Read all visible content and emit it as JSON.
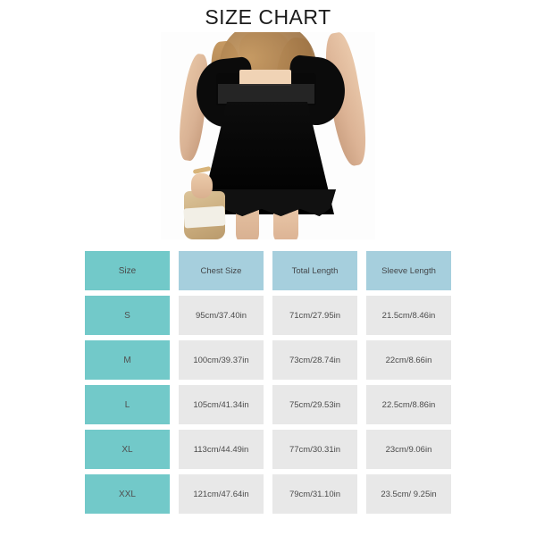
{
  "page": {
    "title": "SIZE CHART",
    "background_color": "#ffffff"
  },
  "colors": {
    "size_column": "#72c9c9",
    "header_measure_column": "#a6cfdd",
    "data_cell": "#e8e8e8",
    "title_text": "#1b1b1b",
    "cell_text": "#4a4a4a"
  },
  "photo": {
    "alt": "Model wearing black lace-trim flutter-sleeve babydoll top with straw bag",
    "garment_color": "#000000"
  },
  "table": {
    "headers": [
      "Size",
      "Chest Size",
      "Total Length",
      "Sleeve Length"
    ],
    "rows": [
      {
        "size": "S",
        "chest": "95cm/37.40in",
        "length": "71cm/27.95in",
        "sleeve": "21.5cm/8.46in"
      },
      {
        "size": "M",
        "chest": "100cm/39.37in",
        "length": "73cm/28.74in",
        "sleeve": "22cm/8.66in"
      },
      {
        "size": "L",
        "chest": "105cm/41.34in",
        "length": "75cm/29.53in",
        "sleeve": "22.5cm/8.86in"
      },
      {
        "size": "XL",
        "chest": "113cm/44.49in",
        "length": "77cm/30.31in",
        "sleeve": "23cm/9.06in"
      },
      {
        "size": "XXL",
        "chest": "121cm/47.64in",
        "length": "79cm/31.10in",
        "sleeve": "23.5cm/ 9.25in"
      }
    ]
  }
}
